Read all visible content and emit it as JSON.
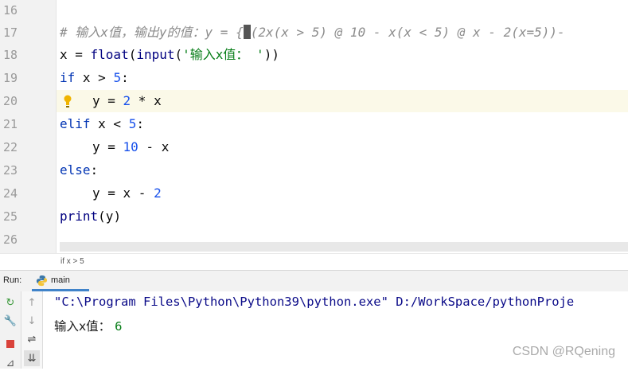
{
  "editor": {
    "line_numbers": [
      "16",
      "17",
      "18",
      "19",
      "20",
      "21",
      "22",
      "23",
      "24",
      "25",
      "26"
    ],
    "code": {
      "l17_comment_a": "# 输入x值，输出y的值：y = {",
      "l17_comment_b": "(2x(x > 5) @ 10 - x(x < 5) @ x - 2(x=5))",
      "l17_end": "-",
      "l18_var": "x = ",
      "l18_func1": "float",
      "l18_p1": "(",
      "l18_func2": "input",
      "l18_p2": "(",
      "l18_str": "'输入x值： '",
      "l18_p3": "))",
      "l19_kw": "if",
      "l19_cond": " x > ",
      "l19_num": "5",
      "l19_colon": ":",
      "l20_a": "y = ",
      "l20_num": "2",
      "l20_b": " * x",
      "l21_kw": "elif",
      "l21_cond": " x < ",
      "l21_num": "5",
      "l21_colon": ":",
      "l22_a": "y = ",
      "l22_num": "10",
      "l22_b": " - x",
      "l23_kw": "else",
      "l23_colon": ":",
      "l24_a": "y = x - ",
      "l24_num": "2",
      "l25_func": "print",
      "l25_arg": "(y)"
    },
    "highlighted_line": "20"
  },
  "breadcrumb": {
    "text": "if x > 5"
  },
  "run_panel": {
    "label": "Run:",
    "tab_label": "main",
    "console_lines": {
      "cmd": "\"C:\\Program Files\\Python\\Python39\\python.exe\" D:/WorkSpace/pythonProje",
      "prompt": "输入x值： ",
      "input_value": "6"
    }
  },
  "watermark": "CSDN @RQening",
  "colors": {
    "keyword": "#0033b3",
    "number": "#1750eb",
    "string": "#067d17",
    "comment": "#8c8c8c",
    "tab_accent": "#4083c9"
  }
}
